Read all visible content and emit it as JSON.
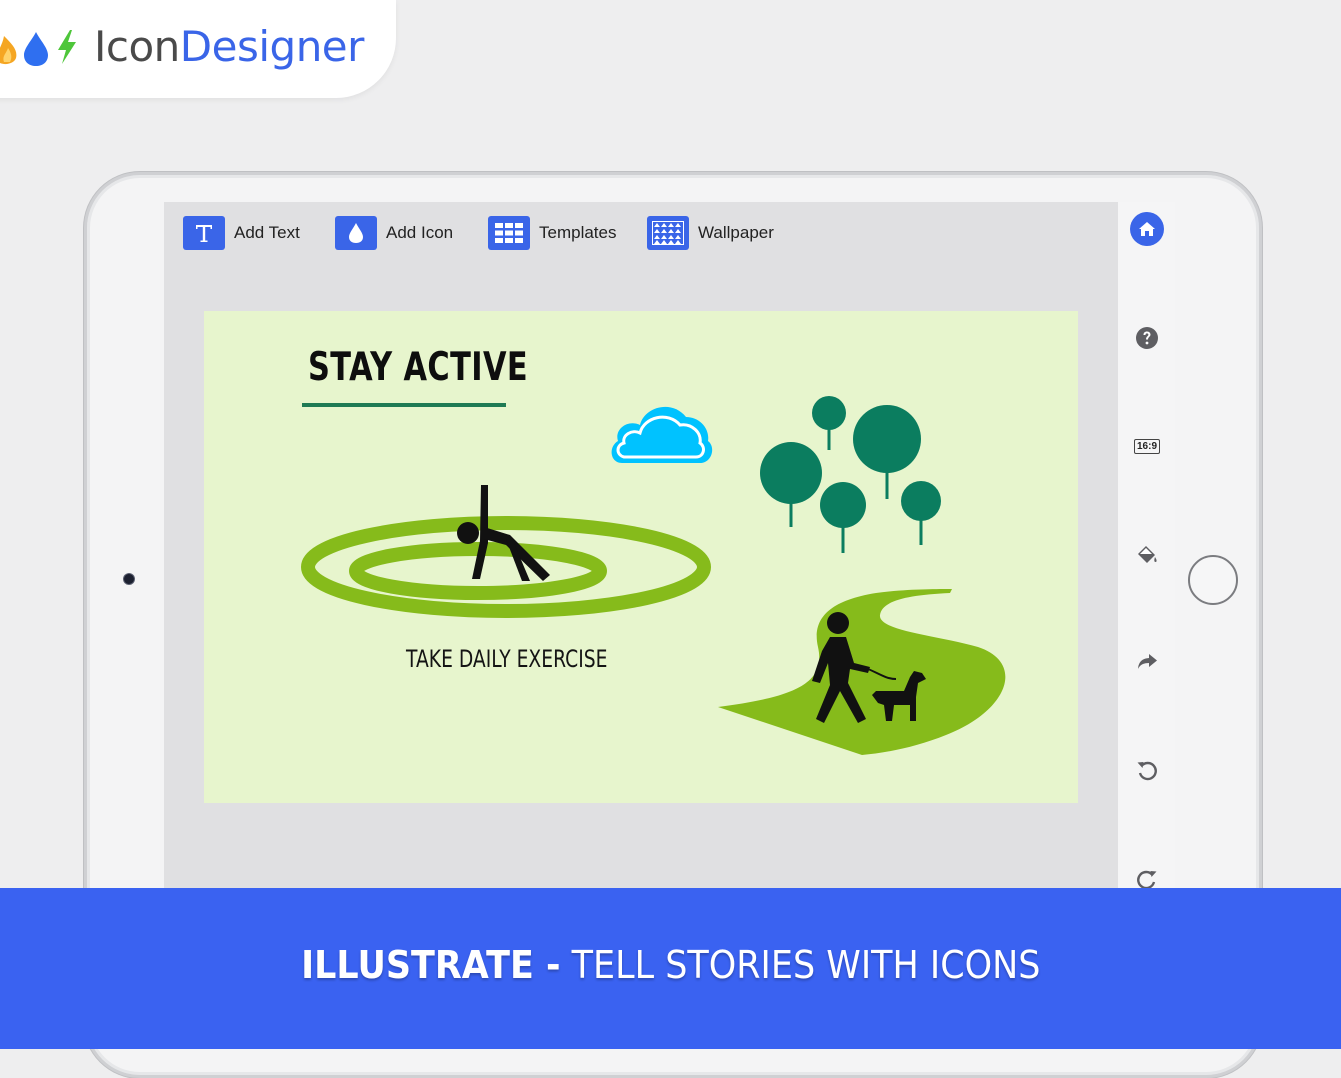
{
  "brand": {
    "name_part1": "Icon",
    "name_part2": "Designer",
    "icons": [
      "flame-icon",
      "drop-icon",
      "lightning-icon"
    ],
    "colors": {
      "flame": "#f5a623",
      "drop": "#2f6ff0",
      "bolt": "#4ec63a",
      "blue": "#3a65e8"
    }
  },
  "toolbar": {
    "add_text": "Add Text",
    "add_icon": "Add Icon",
    "templates": "Templates",
    "wallpaper": "Wallpaper"
  },
  "rail": {
    "aspect_ratio": "16:9",
    "icons": [
      "home-icon",
      "help-icon",
      "aspect-ratio-icon",
      "fill-bucket-icon",
      "share-icon",
      "undo-icon",
      "redo-icon"
    ]
  },
  "design": {
    "title": "STAY ACTIVE",
    "caption": "TAKE DAILY EXERCISE",
    "background": "#e7f5cd",
    "colors": {
      "ring": "#86bb1b",
      "tree": "#0b7d5f",
      "cloud": "#00c2ff",
      "path": "#86bb1b",
      "underline": "#1f7a54"
    }
  },
  "banner": {
    "bold": "ILLUSTRATE -",
    "rest": "TELL STORIES WITH ICONS",
    "color": "#3a62f1"
  }
}
